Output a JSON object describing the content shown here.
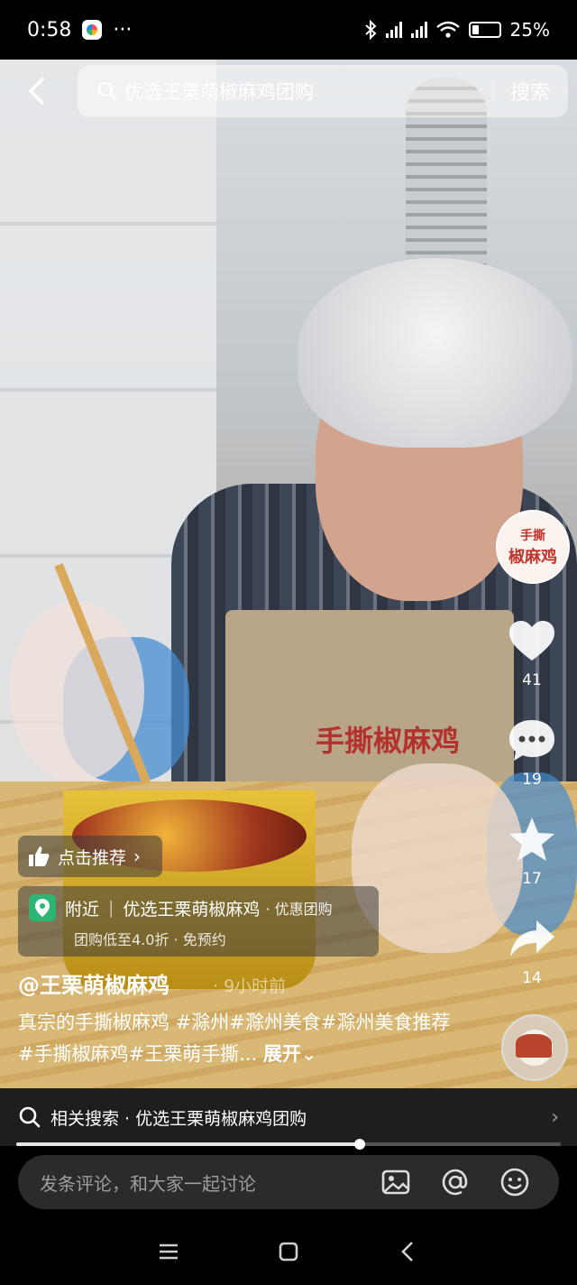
{
  "status_bar": {
    "time": "0:58",
    "more": "···",
    "battery_text": "25%",
    "battery_level": 0.25
  },
  "search": {
    "query": "优选王栗萌椒麻鸡团购",
    "button_label": "搜索"
  },
  "video_overlay_text": {
    "apron_brand": "手撕椒麻鸡"
  },
  "right_rail": {
    "avatar_line1": "手撕",
    "avatar_line2": "椒麻鸡",
    "like_count": "41",
    "comment_count": "19",
    "favorite_count": "17",
    "share_count": "14"
  },
  "recommend": {
    "label": "点击推荐",
    "arrow": "›"
  },
  "poi": {
    "tag": "附近",
    "name": "优选王栗萌椒麻鸡",
    "suffix": "· 优惠团购",
    "detail": "团购低至4.0折 · 免预约"
  },
  "post": {
    "author": "@王栗萌椒麻鸡",
    "time_ago": "· 9小时前",
    "caption": "真宗的手撕椒麻鸡 #滁州#滁州美食#滁州美食推荐#手撕椒麻鸡#王栗萌手撕...",
    "expand": "展开"
  },
  "related_search": {
    "label": "相关搜索 · 优选王栗萌椒麻鸡团购",
    "chevron": "›"
  },
  "playback": {
    "progress": 0.63
  },
  "comment": {
    "placeholder": "发条评论，和大家一起讨论"
  },
  "colors": {
    "accent_green": "#2bb673",
    "brand_red": "#c0342b"
  }
}
